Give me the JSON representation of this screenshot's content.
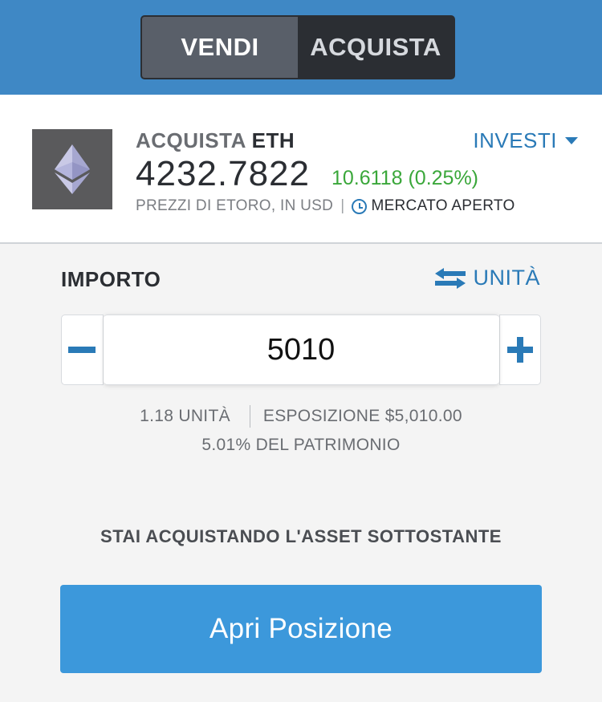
{
  "header": {
    "sell_label": "VENDI",
    "buy_label": "ACQUISTA"
  },
  "asset": {
    "action": "ACQUISTA",
    "symbol": "ETH",
    "invest_label": "INVESTI",
    "price": "4232.7822",
    "change": "10.6118",
    "change_pct": "(0.25%)",
    "source": "PREZZI DI ETORO, IN USD",
    "separator": "|",
    "market_status": "MERCATO APERTO",
    "logo_icon": "ethereum-icon",
    "change_color": "#3aa73a"
  },
  "amount": {
    "label": "IMPORTO",
    "units_toggle": "UNITÀ",
    "value": "5010",
    "units": "1.18 UNITÀ",
    "exposure": "ESPOSIZIONE $5,010.00",
    "equity_pct": "5.01% DEL PATRIMONIO"
  },
  "notice": "STAI ACQUISTANDO L'ASSET SOTTOSTANTE",
  "action_button": "Apri Posizione",
  "colors": {
    "header": "#3f88c5",
    "accent": "#2a7ab7",
    "primary_button": "#3c98db"
  }
}
